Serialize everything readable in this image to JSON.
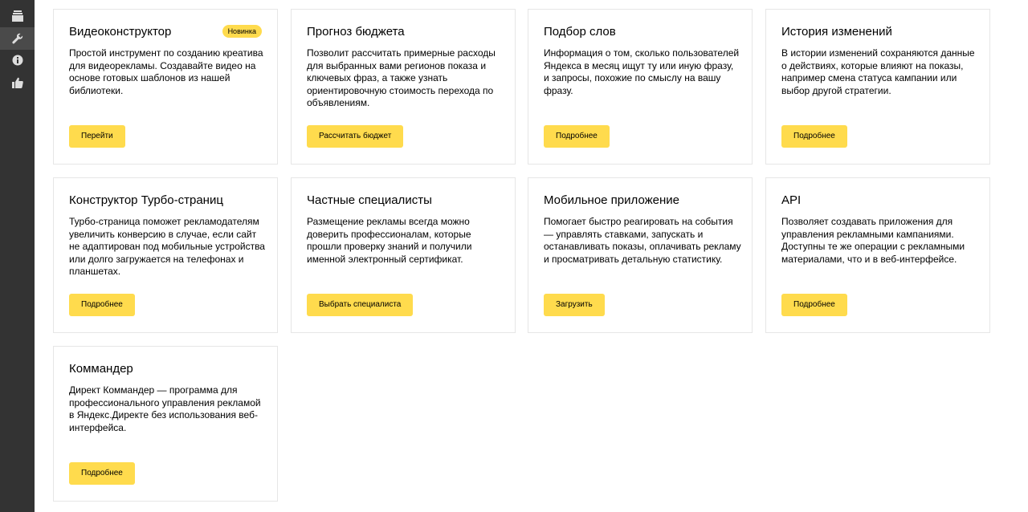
{
  "sidebar": {
    "items": [
      {
        "icon": "campaigns-stack-icon"
      },
      {
        "icon": "wrench-icon"
      },
      {
        "icon": "info-icon"
      },
      {
        "icon": "thumbs-up-icon"
      }
    ]
  },
  "cards": [
    {
      "title": "Видеоконструктор",
      "badge": "Новинка",
      "desc": "Простой инструмент по созданию креатива для видеорекламы. Создавайте видео на основе готовых шаблонов из нашей библиотеки.",
      "button": "Перейти"
    },
    {
      "title": "Прогноз бюджета",
      "desc": "Позволит рассчитать примерные расходы для выбранных вами регионов показа и ключевых фраз, а также узнать ориентировочную стоимость перехода по объявлениям.",
      "button": "Рассчитать бюджет"
    },
    {
      "title": "Подбор слов",
      "desc": "Информация о том, сколько пользователей Яндекса в месяц ищут ту или иную фразу, и запросы, похожие по смыслу на вашу фразу.",
      "button": "Подробнее"
    },
    {
      "title": "История изменений",
      "desc": "В истории изменений сохраняются данные о действиях, которые влияют на показы, например смена статуса кампании или выбор другой стратегии.",
      "button": "Подробнее"
    },
    {
      "title": "Конструктор Турбо-страниц",
      "desc": "Турбо-страница поможет рекламодателям увеличить конверсию в случае, если сайт не адаптирован под мобильные устройства или долго загружается на телефонах и планшетах.",
      "button": "Подробнее"
    },
    {
      "title": "Частные специалисты",
      "desc": "Размещение рекламы всегда можно доверить профессионалам, которые прошли проверку знаний и получили именной электронный сертификат.",
      "button": "Выбрать специалиста"
    },
    {
      "title": "Мобильное приложение",
      "desc": "Помогает быстро реагировать на события — управлять ставками, запускать и останавливать показы, оплачивать рекламу и просматривать детальную статистику.",
      "button": "Загрузить"
    },
    {
      "title": "API",
      "desc": "Позволяет создавать приложения для управления рекламными кампаниями. Доступны те же операции с рекламными материалами, что и в веб-интерфейсе.",
      "button": "Подробнее"
    },
    {
      "title": "Коммандер",
      "desc": "Директ Коммандер — программа для профессионального управления рекламой в Яндекс.Директе без использования веб-интерфейса.",
      "button": "Подробнее"
    }
  ],
  "colors": {
    "sidebar_bg": "#333333",
    "accent_yellow": "#ffdb4d",
    "card_border": "#e6e6e6"
  }
}
